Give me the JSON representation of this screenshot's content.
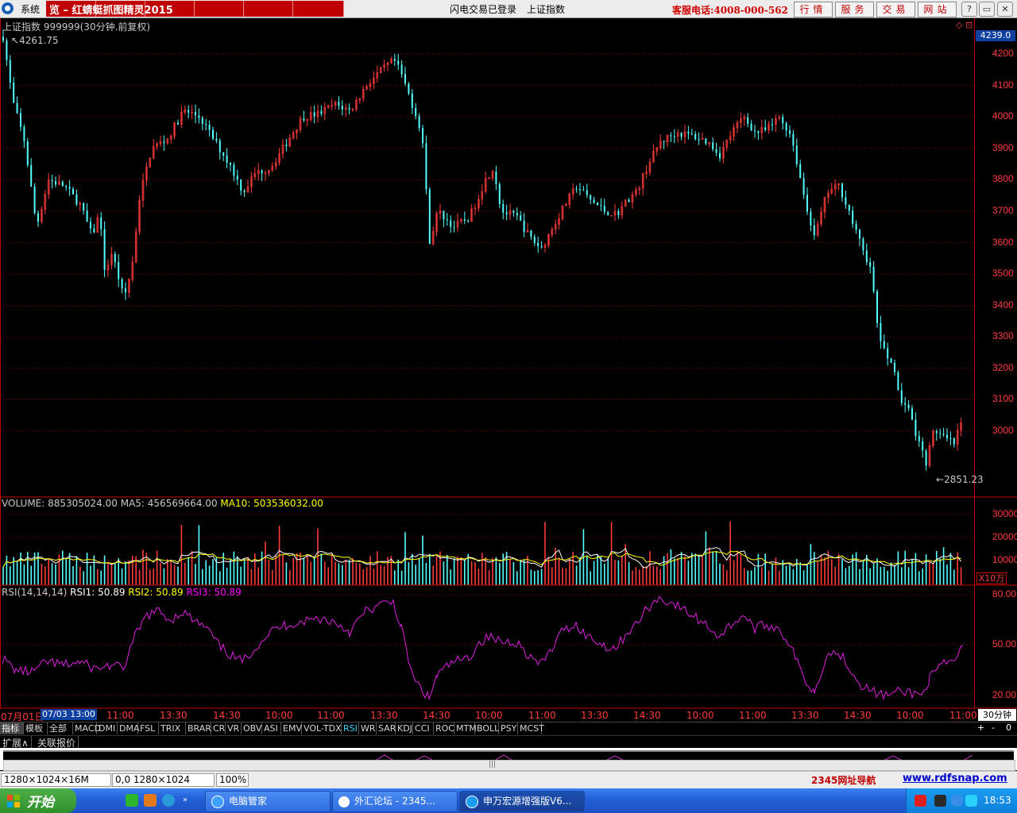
{
  "topbar": {
    "menu_system": "系统",
    "title": "览  –  红蜻蜓抓图精灵2015",
    "login_status": "闪电交易已登录",
    "current_index": "上证指数",
    "hotline": "客服电话:4008-000-562",
    "nav_buttons": [
      "行情",
      "服务",
      "交易",
      "网站"
    ],
    "window_buttons": [
      "?",
      "▭",
      "▢",
      "✕"
    ]
  },
  "main_chart": {
    "title": "上证指数 999999(30分钟.前复权)",
    "current_price": "4239.0",
    "high_label": "4261.75",
    "low_label": "2851.23",
    "y_ticks": [
      "4200",
      "4100",
      "4000",
      "3900",
      "3800",
      "3700",
      "3600",
      "3500",
      "3400",
      "3300",
      "3200",
      "3100",
      "3000"
    ],
    "corner_marks": "◇ ⊡"
  },
  "volume": {
    "label": "VOLUME: 885305024.00",
    "ma5": "MA5: 456569664.00",
    "ma10": "MA10: 503536032.00",
    "y_ticks": [
      "30000",
      "20000",
      "10000"
    ],
    "unit_box": "X10万",
    "colors": {
      "ma5": "#ffffff",
      "ma10": "#ffff00"
    }
  },
  "rsi": {
    "label": "RSI(14,14,14)",
    "rsi1": "RSI1: 50.89",
    "rsi2": "RSI2: 50.89",
    "rsi3": "RSI3: 50.89",
    "y_ticks": [
      "80.00",
      "50.00",
      "20.00"
    ],
    "colors": {
      "rsi1": "#ffffff",
      "rsi2": "#ffff00",
      "rsi3": "#ff00ff"
    }
  },
  "x_axis": {
    "start_date": "07月01日",
    "cursor_date": "07/03 13:00",
    "labels": [
      "11:00",
      "13:30",
      "14:30",
      "10:00",
      "11:00",
      "13:30",
      "14:30",
      "10:00",
      "11:00",
      "13:30",
      "14:30",
      "10:00",
      "11:00",
      "13:30",
      "14:30",
      "10:00",
      "11:00"
    ],
    "period": "30分钟"
  },
  "indicator_tabs": [
    "指标",
    "模板",
    "全部",
    "MACD",
    "DMI",
    "DMA",
    "FSL",
    "TRIX",
    "BRAR",
    "CR",
    "VR",
    "OBV",
    "ASI",
    "EMV",
    "VOL-TDX",
    "RSI",
    "WR",
    "SAR",
    "KDJ",
    "CCI",
    "ROC",
    "MTM",
    "BOLL",
    "PSY",
    "MCST"
  ],
  "selected_tab": "RSI",
  "tab_controls": [
    "+",
    "-",
    "0"
  ],
  "extend_tabs": [
    "扩展∧",
    "关联报价"
  ],
  "statusbar": {
    "resolution": "1280×1024×16M",
    "coords": "0,0 1280×1024",
    "zoom": "100%",
    "nav_site": "2345网址导航",
    "link": "www.rdfsnap.com"
  },
  "taskbar": {
    "start": "开始",
    "tasks": [
      "电脑管家",
      "外汇论坛 - 2345...",
      "申万宏源增强版V6..."
    ],
    "clock": "18:53"
  },
  "theme": {
    "up": "#ff3b3b",
    "down": "#54ffff",
    "grid": "#8b0000",
    "rsi_line": "#e020e0"
  }
}
